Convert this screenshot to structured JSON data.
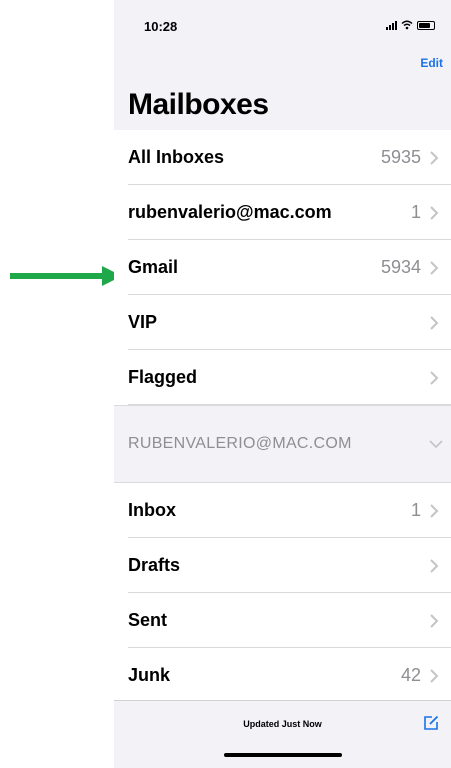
{
  "status": {
    "time": "10:28"
  },
  "header": {
    "edit_label": "Edit",
    "title": "Mailboxes"
  },
  "mailboxes": [
    {
      "label": "All Inboxes",
      "count": "5935"
    },
    {
      "label": "rubenvalerio@mac.com",
      "count": "1"
    },
    {
      "label": "Gmail",
      "count": "5934"
    },
    {
      "label": "VIP",
      "count": ""
    },
    {
      "label": "Flagged",
      "count": ""
    }
  ],
  "account_section": {
    "label": "RUBENVALERIO@MAC.COM"
  },
  "account_items": [
    {
      "label": "Inbox",
      "count": "1"
    },
    {
      "label": "Drafts",
      "count": ""
    },
    {
      "label": "Sent",
      "count": ""
    },
    {
      "label": "Junk",
      "count": "42"
    }
  ],
  "toolbar": {
    "status_text": "Updated Just Now"
  },
  "colors": {
    "accent": "#1a73e8",
    "arrow": "#1ea84a",
    "secondary_text": "#8e8e93"
  },
  "icons": [
    "signal-icon",
    "wifi-icon",
    "battery-icon",
    "chevron-right-icon",
    "chevron-down-icon",
    "compose-icon",
    "arrow-icon"
  ]
}
